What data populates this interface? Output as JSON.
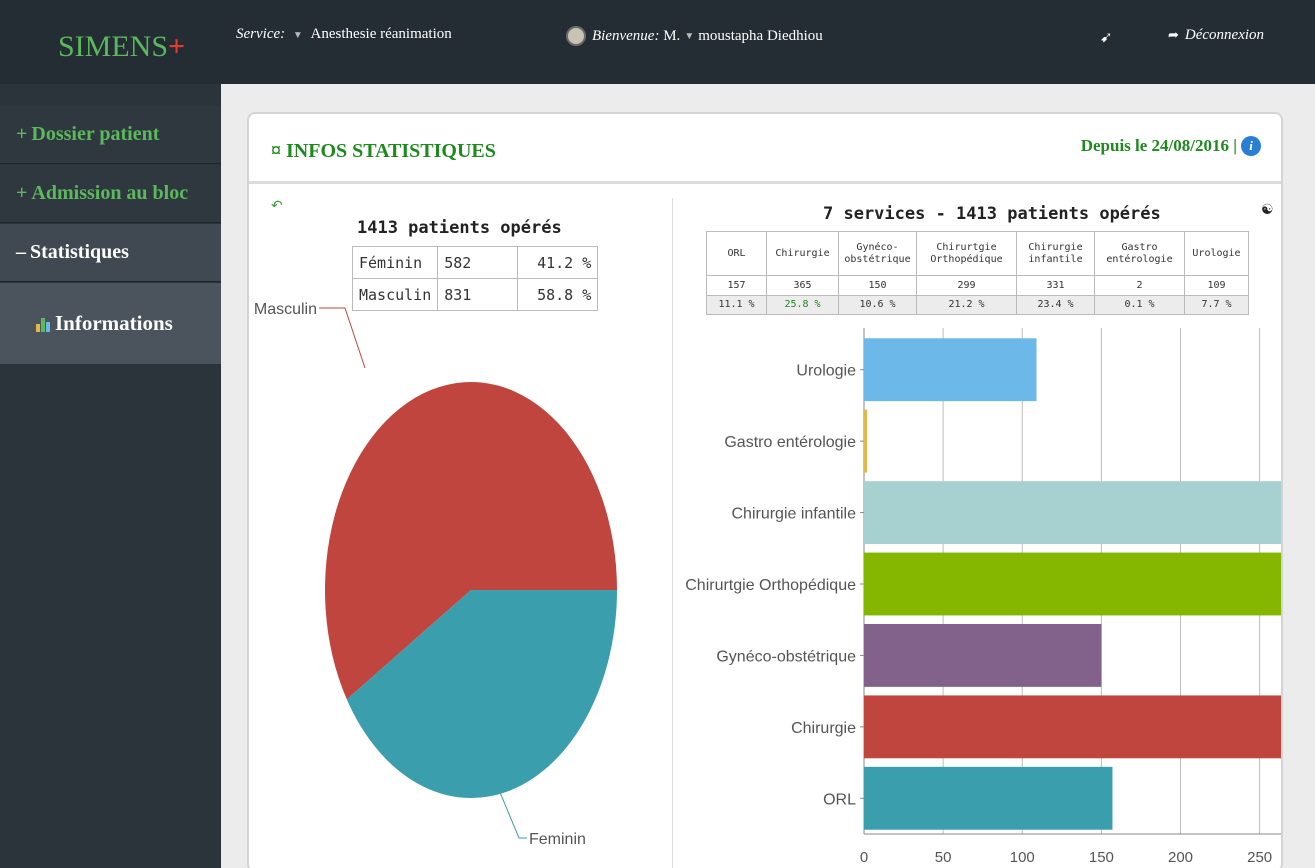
{
  "app": {
    "logo_text": "SIMENS",
    "logo_plus": "+"
  },
  "topbar": {
    "service_label": "Service:",
    "service_value": "Anesthesie réanimation",
    "welcome_label": "Bienvenue:",
    "welcome_title": "M.",
    "welcome_name": "moustapha Diedhiou",
    "logout_label": "Déconnexion"
  },
  "sidebar": {
    "items": [
      {
        "label": "Dossier patient",
        "glyph": "+"
      },
      {
        "label": "Admission au bloc",
        "glyph": "+"
      },
      {
        "label": "Statistiques",
        "glyph": "–"
      }
    ],
    "sub_item": {
      "label": "Informations"
    }
  },
  "card": {
    "title": "INFOS STATISTIQUES",
    "title_glyph": "¤",
    "since": "Depuis le 24/08/2016 |",
    "info_glyph": "i"
  },
  "gender": {
    "title": "1413 patients opérés",
    "rows": [
      {
        "label": "Féminin",
        "count": "582",
        "percent": "41.2 %"
      },
      {
        "label": "Masculin",
        "count": "831",
        "percent": "58.8 %"
      }
    ]
  },
  "services_table": {
    "title": "7 services - 1413 patients opérés",
    "headers": [
      "ORL",
      "Chirurgie",
      "Gynéco-obstétrique",
      "Chirurtgie Orthopédique",
      "Chirurgie infantile",
      "Gastro entérologie",
      "Urologie"
    ],
    "counts": [
      "157",
      "365",
      "150",
      "299",
      "331",
      "2",
      "109"
    ],
    "percents": [
      "11.1 %",
      "25.8 %",
      "10.6 %",
      "21.2 %",
      "23.4 %",
      "0.1 %",
      "7.7 %"
    ]
  },
  "colors": {
    "green": "#1e8a1e",
    "pie_masculin": "#c0453f",
    "pie_feminin": "#3a9eac"
  },
  "chart_data": [
    {
      "type": "pie",
      "labels": [
        "Masculin",
        "Feminin"
      ],
      "values": [
        831,
        582
      ],
      "colors": [
        "#c0453f",
        "#3a9eac"
      ]
    },
    {
      "type": "bar",
      "orientation": "horizontal",
      "categories": [
        "Urologie",
        "Gastro entérologie",
        "Chirurgie infantile",
        "Chirurtgie Orthopédique",
        "Gynéco-obstétrique",
        "Chirurgie",
        "ORL"
      ],
      "values": [
        109,
        2,
        331,
        299,
        150,
        365,
        157
      ],
      "colors": [
        "#6cb8e8",
        "#e0b84a",
        "#a7d1d0",
        "#86b700",
        "#82628a",
        "#c0453f",
        "#3a9eac"
      ],
      "xlim": [
        0,
        400
      ],
      "xticks": [
        "0",
        "50",
        "100",
        "150",
        "200",
        "250",
        "300",
        "350",
        "400"
      ],
      "grid": true
    }
  ]
}
